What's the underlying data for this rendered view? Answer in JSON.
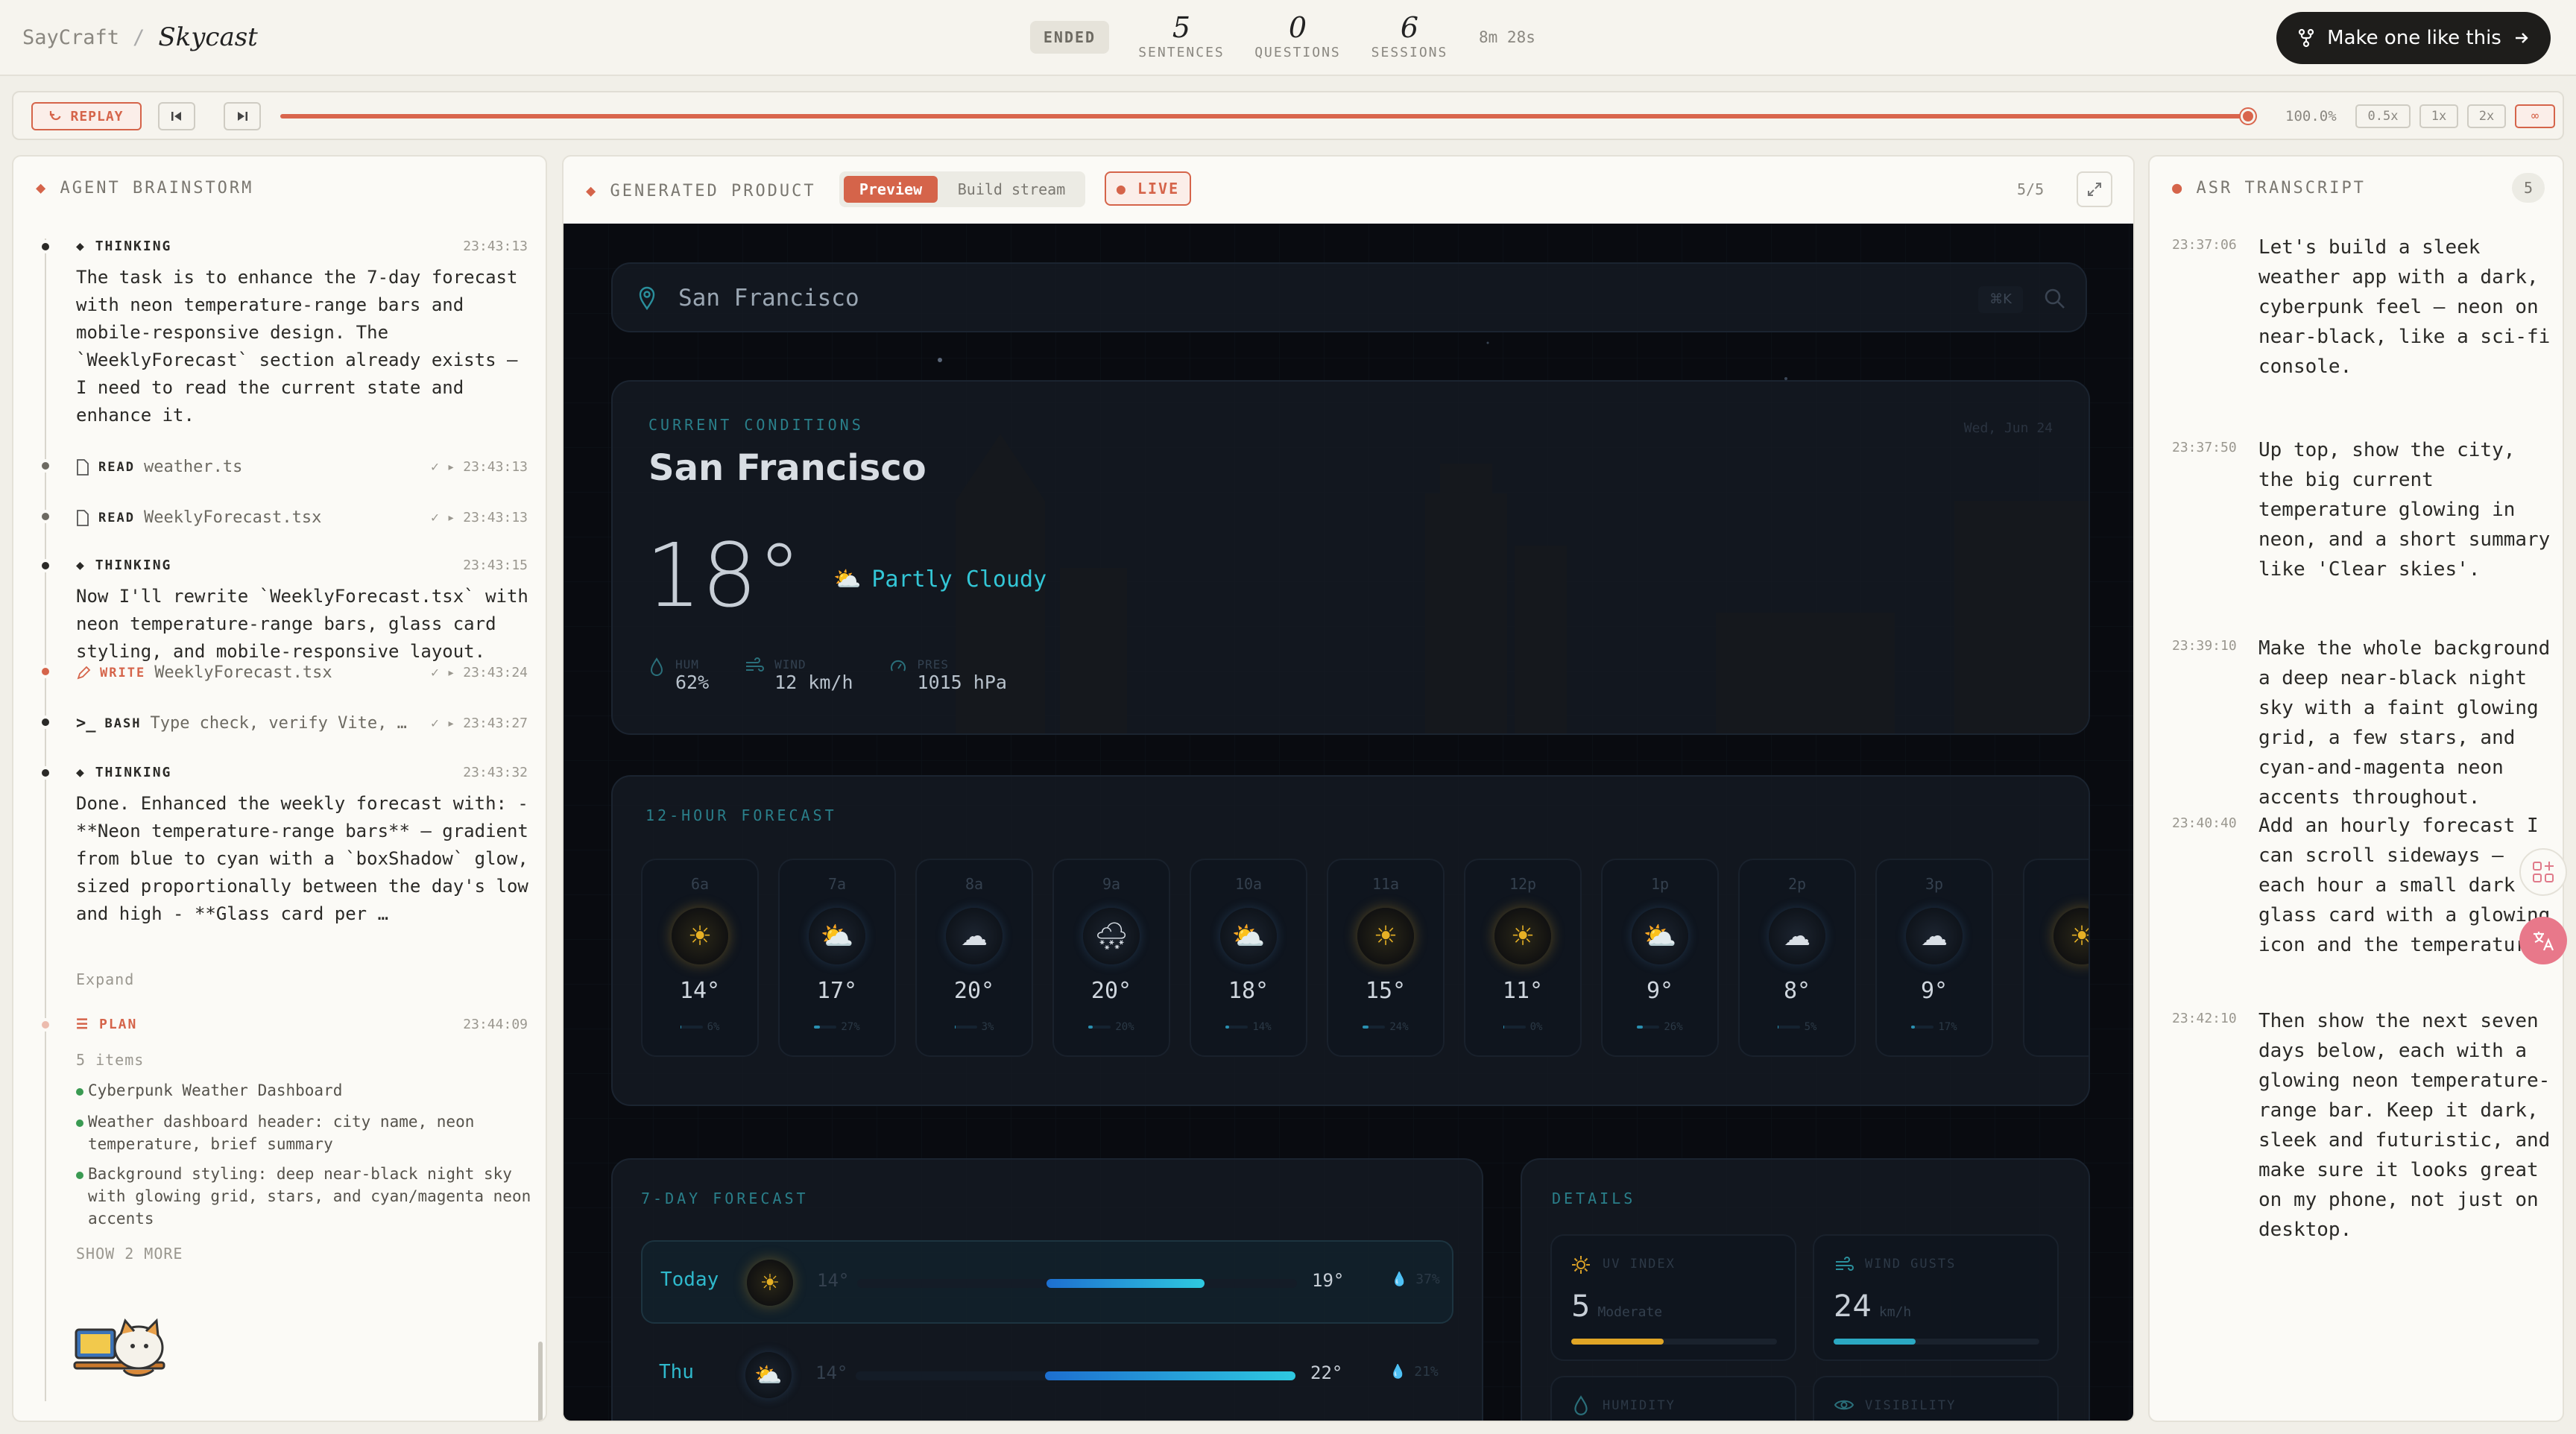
{
  "header": {
    "brand": "SayCraft",
    "separator": "/",
    "app_name": "Skycast",
    "status": "ENDED",
    "stats": [
      {
        "value": "5",
        "label": "SENTENCES"
      },
      {
        "value": "0",
        "label": "QUESTIONS"
      },
      {
        "value": "6",
        "label": "SESSIONS"
      }
    ],
    "duration": "8m 28s",
    "cta_label": "Make one like this"
  },
  "playback": {
    "replay_label": "REPLAY",
    "progress_text": "100.0%",
    "progress": 1.0,
    "speeds": [
      "0.5x",
      "1x",
      "2x",
      "∞"
    ],
    "active_speed": "∞"
  },
  "agent": {
    "title": "AGENT BRAINSTORM",
    "entries": [
      {
        "type": "THINKING",
        "time": "23:43:13",
        "text": "The task is to enhance the 7-day forecast\nwith neon temperature-range bars and\nmobile-responsive design. The\n`WeeklyForecast` section already exists —\nI need to read the current state and\nenhance it."
      },
      {
        "type": "READ",
        "target": "weather.ts",
        "time": "✓ ▸ 23:43:13"
      },
      {
        "type": "READ",
        "target": "WeeklyForecast.tsx",
        "time": "✓ ▸ 23:43:13"
      },
      {
        "type": "THINKING",
        "time": "23:43:15",
        "text": "Now I'll rewrite `WeeklyForecast.tsx` with\nneon temperature-range bars, glass card\nstyling, and mobile-responsive layout."
      },
      {
        "type": "WRITE",
        "target": "WeeklyForecast.tsx",
        "time": "✓ ▸ 23:43:24"
      },
      {
        "type": "BASH",
        "target": "Type check, verify Vite, …",
        "time": "✓ ▸ 23:43:27"
      },
      {
        "type": "THINKING",
        "time": "23:43:32",
        "text": "Done. Enhanced the weekly forecast with: -\n**Neon temperature-range bars** — gradient\nfrom blue to cyan with a `boxShadow` glow,\nsized proportionally between the day's low\nand high - **Glass card per …"
      },
      {
        "type": "PLAN",
        "time": "23:44:09"
      }
    ],
    "expand_label": "Expand",
    "plan": {
      "count": "5 items",
      "items": [
        "Cyberpunk Weather Dashboard",
        "Weather dashboard header: city name, neon temperature, brief summary",
        "Background styling: deep near-black night sky with glowing grid, stars, and cyan/magenta neon accents"
      ],
      "more": "SHOW 2 MORE"
    }
  },
  "product": {
    "title": "GENERATED PRODUCT",
    "tabs": [
      "Preview",
      "Build stream"
    ],
    "live_label": "LIVE",
    "pages": "5/5",
    "app": {
      "search_value": "San Francisco",
      "kbd_hint": "⌘K",
      "current": {
        "caption": "CURRENT CONDITIONS",
        "date": "Wed, Jun 24",
        "city": "San Francisco",
        "temp": "18°",
        "condition": "Partly Cloudy",
        "metrics": [
          {
            "label": "HUM",
            "value": "62%"
          },
          {
            "label": "WIND",
            "value": "12 km/h"
          },
          {
            "label": "PRES",
            "value": "1015 hPa"
          }
        ]
      },
      "hourly": {
        "caption": "12-HOUR FORECAST",
        "hours": [
          {
            "time": "6a",
            "icon": "sun-icon",
            "temp": "14°",
            "precip": "6%",
            "precip_level": 0.06
          },
          {
            "time": "7a",
            "icon": "partly-cloudy-icon",
            "temp": "17°",
            "precip": "27%",
            "precip_level": 0.27
          },
          {
            "time": "8a",
            "icon": "cloud-icon",
            "temp": "20°",
            "precip": "3%",
            "precip_level": 0.03
          },
          {
            "time": "9a",
            "icon": "snow-icon",
            "temp": "20°",
            "precip": "20%",
            "precip_level": 0.2
          },
          {
            "time": "10a",
            "icon": "partly-cloudy-icon",
            "temp": "18°",
            "precip": "14%",
            "precip_level": 0.14
          },
          {
            "time": "11a",
            "icon": "sun-icon",
            "temp": "15°",
            "precip": "24%",
            "precip_level": 0.24
          },
          {
            "time": "12p",
            "icon": "sun-icon",
            "temp": "11°",
            "precip": "0%",
            "precip_level": 0.0
          },
          {
            "time": "1p",
            "icon": "partly-cloudy-icon",
            "temp": "9°",
            "precip": "26%",
            "precip_level": 0.26
          },
          {
            "time": "2p",
            "icon": "cloud-icon",
            "temp": "8°",
            "precip": "5%",
            "precip_level": 0.05
          },
          {
            "time": "3p",
            "icon": "cloud-icon",
            "temp": "9°",
            "precip": "17%",
            "precip_level": 0.17
          }
        ]
      },
      "weekly": {
        "caption": "7-DAY FORECAST",
        "days": [
          {
            "day": "Today",
            "icon": "sun-icon",
            "low": "14°",
            "high": "19°",
            "precip": "37%",
            "range_start": 0.43,
            "range_end": 0.79
          },
          {
            "day": "Thu",
            "icon": "partly-cloudy-icon",
            "low": "14°",
            "high": "22°",
            "precip": "21%",
            "range_start": 0.43,
            "range_end": 1.0
          }
        ]
      },
      "details": {
        "caption": "DETAILS",
        "items": [
          {
            "label": "UV INDEX",
            "value": "5",
            "unit": "Moderate",
            "level": 0.45,
            "color": "#e0a526"
          },
          {
            "label": "WIND GUSTS",
            "value": "24",
            "unit": "km/h",
            "level": 0.4,
            "color": "#2ba8c2"
          },
          {
            "label": "HUMIDITY",
            "value": "",
            "unit": "",
            "level": 0,
            "color": "#2ba8c2"
          },
          {
            "label": "VISIBILITY",
            "value": "",
            "unit": "",
            "level": 0,
            "color": "#2ba8c2"
          }
        ]
      }
    }
  },
  "transcript": {
    "title": "ASR TRANSCRIPT",
    "count": "5",
    "items": [
      {
        "time": "23:37:06",
        "text": "Let's build a sleek weather app with a dark, cyberpunk feel — neon on near-black, like a sci-fi console."
      },
      {
        "time": "23:37:50",
        "text": "Up top, show the city, the big current temperature glowing in neon, and a short summary like 'Clear skies'."
      },
      {
        "time": "23:39:10",
        "text": "Make the whole background a deep near-black night sky with a faint glowing grid, a few stars, and cyan-and-magenta neon accents throughout."
      },
      {
        "time": "23:40:40",
        "text": "Add an hourly forecast I can scroll sideways — each hour a small dark glass card with a glowing icon and the temperature."
      },
      {
        "time": "23:42:10",
        "text": "Then show the next seven days below, each with a glowing neon temperature-range bar. Keep it dark, sleek and futuristic, and make sure it looks great on my phone, not just on desktop."
      }
    ]
  },
  "colors": {
    "accent": "#d5644a",
    "neon_cyan": "#33c6d6",
    "app_bg": "#090b10"
  }
}
